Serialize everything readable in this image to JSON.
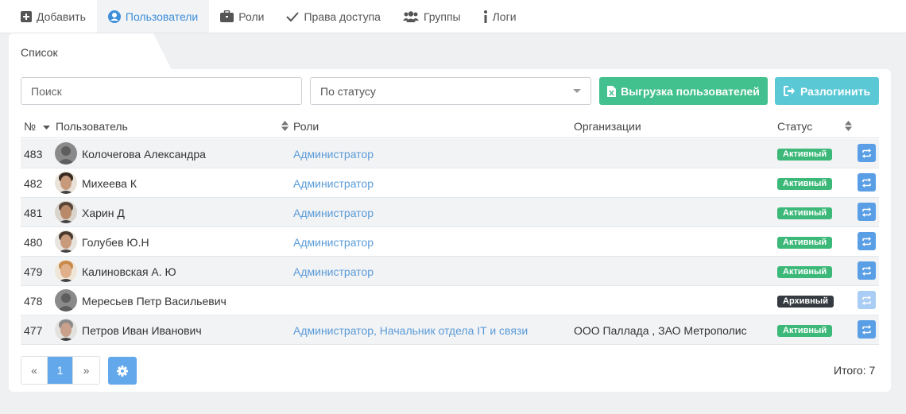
{
  "nav": {
    "add": "Добавить",
    "users": "Пользователи",
    "roles": "Роли",
    "access": "Права доступа",
    "groups": "Группы",
    "logs": "Логи"
  },
  "tab": {
    "label": "Список"
  },
  "filters": {
    "search_placeholder": "Поиск",
    "status_value": "По статусу",
    "export_label": "Выгрузка пользователей",
    "logout_label": "Разлогинить"
  },
  "table": {
    "columns": {
      "num": "№",
      "user": "Пользователь",
      "roles": "Роли",
      "orgs": "Организации",
      "status": "Статус"
    },
    "rows": [
      {
        "num": "483",
        "name": "Колочегова Александра",
        "roles": "Администратор",
        "orgs": "",
        "status": "Активный"
      },
      {
        "num": "482",
        "name": "Михеева К",
        "roles": "Администратор",
        "orgs": "",
        "status": "Активный"
      },
      {
        "num": "481",
        "name": "Харин Д",
        "roles": "Администратор",
        "orgs": "",
        "status": "Активный"
      },
      {
        "num": "480",
        "name": "Голубев Ю.Н",
        "roles": "Администратор",
        "orgs": "",
        "status": "Активный"
      },
      {
        "num": "479",
        "name": "Калиновская А. Ю",
        "roles": "Администратор",
        "orgs": "",
        "status": "Активный"
      },
      {
        "num": "478",
        "name": "Мересьев Петр Васильевич",
        "roles": "",
        "orgs": "",
        "status": "Архивный"
      },
      {
        "num": "477",
        "name": "Петров Иван Иванович",
        "roles": "Администратор, Начальник отдела IT и связи",
        "orgs": "ООО Паллада , ЗАО Метрополис",
        "status": "Активный"
      }
    ]
  },
  "pager": {
    "prev": "«",
    "current": "1",
    "next": "»"
  },
  "footer": {
    "total": "Итого: 7"
  },
  "colors": {
    "accent": "#3e8ed9",
    "green": "#42c08e",
    "teal": "#5bc8d6",
    "archive": "#343a40"
  }
}
